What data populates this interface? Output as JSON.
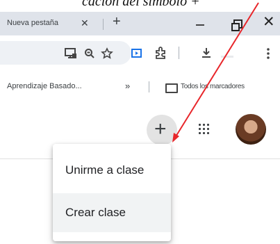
{
  "caption": {
    "text": "cación del símbolo +"
  },
  "tabstrip": {
    "tab_title": "Nueva pestaña",
    "tab_close": "✕",
    "new_tab": "+",
    "minimize": "—",
    "close": "✕"
  },
  "toolbar": {
    "icons": [
      "cast-icon",
      "zoom-icon",
      "star-icon",
      "media-icon",
      "extensions-icon",
      "download-icon",
      "menu-icon"
    ]
  },
  "bookmarks": {
    "item_1": "Aprendizaje Basado...",
    "more": "»",
    "all_bookmarks": "Todos los marcadores"
  },
  "header": {
    "create_button_label": "+"
  },
  "menu": {
    "items": [
      {
        "label": "Unirme a clase"
      },
      {
        "label": "Crear clase"
      }
    ]
  },
  "colors": {
    "tabstrip_bg": "#dfe3ea",
    "annotation_arrow": "#e8262a",
    "menu_hover": "#f1f3f4"
  }
}
